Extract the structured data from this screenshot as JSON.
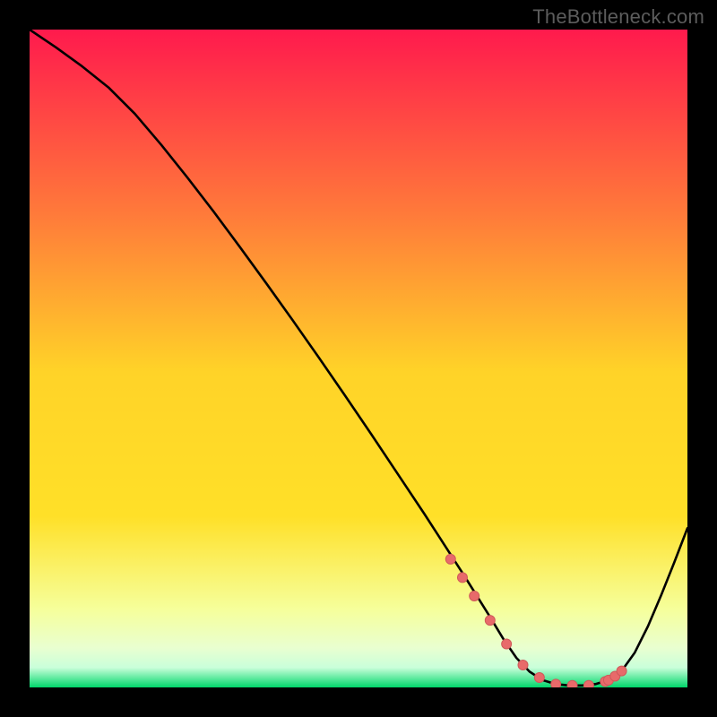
{
  "watermark": "TheBottleneck.com",
  "colors": {
    "bg": "#000000",
    "curve": "#000000",
    "marker_fill": "#e86a6a",
    "marker_stroke": "#cf5a5a",
    "gradient_top": "#ff1a4d",
    "gradient_mid_upper": "#ff9a3a",
    "gradient_mid": "#ffe028",
    "gradient_mid_lower": "#f9ff6a",
    "gradient_pale": "#f2ffbf",
    "gradient_bottom": "#00d66b"
  },
  "chart_data": {
    "type": "line",
    "title": "",
    "xlabel": "",
    "ylabel": "",
    "xlim": [
      0,
      100
    ],
    "ylim": [
      0,
      100
    ],
    "grid": false,
    "legend": null,
    "series": [
      {
        "name": "curve",
        "x": [
          0,
          4,
          8,
          12,
          16,
          20,
          24,
          28,
          32,
          36,
          40,
          44,
          48,
          52,
          56,
          60,
          62,
          64,
          66,
          68,
          70,
          72,
          74,
          76,
          78,
          80,
          82,
          84,
          86,
          88,
          90,
          92,
          94,
          96,
          98,
          100
        ],
        "y": [
          100,
          97.3,
          94.4,
          91.2,
          87.2,
          82.5,
          77.5,
          72.3,
          66.9,
          61.4,
          55.8,
          50.1,
          44.3,
          38.4,
          32.4,
          26.4,
          23.3,
          20.2,
          17.1,
          13.9,
          10.7,
          7.4,
          4.5,
          2.4,
          1.1,
          0.5,
          0.3,
          0.3,
          0.5,
          1.1,
          2.5,
          5.3,
          9.3,
          14.0,
          19.0,
          24.2
        ]
      }
    ],
    "markers": {
      "x": [
        64.0,
        65.8,
        67.6,
        70.0,
        72.5,
        75.0,
        77.5,
        80.0,
        82.5,
        85.0,
        87.5,
        88.0,
        89.0,
        90.0
      ],
      "y": [
        19.5,
        16.7,
        13.9,
        10.2,
        6.6,
        3.4,
        1.5,
        0.5,
        0.3,
        0.3,
        0.9,
        1.1,
        1.7,
        2.5
      ]
    },
    "annotations": []
  }
}
